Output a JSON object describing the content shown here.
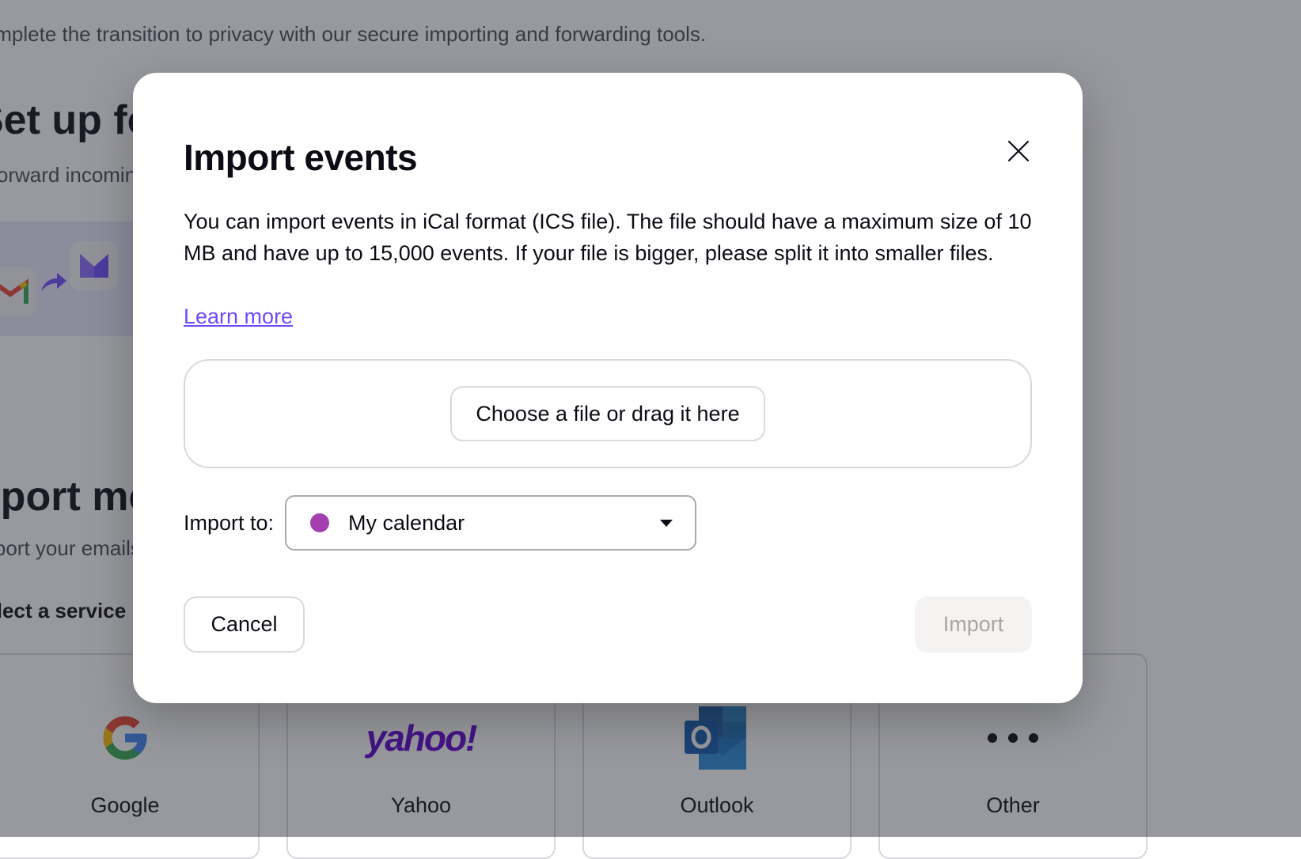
{
  "background": {
    "intro_text": "Complete the transition to privacy with our secure importing and forwarding tools.",
    "forward_section": {
      "title": "Set up forwarding",
      "subtitle": "Forward incoming mail"
    },
    "import_section": {
      "title": "Import messages",
      "subtitle": "Import your emails",
      "select_service_label": "Select a service"
    },
    "services": [
      {
        "name": "Google",
        "icon": "google-logo"
      },
      {
        "name": "Yahoo",
        "icon": "yahoo-logo"
      },
      {
        "name": "Outlook",
        "icon": "outlook-logo"
      },
      {
        "name": "Other",
        "icon": "more-dots-icon"
      }
    ]
  },
  "modal": {
    "title": "Import events",
    "description": "You can import events in iCal format (ICS file). The file should have a maximum size of 10 MB and have up to 15,000 events. If your file is bigger, please split it into smaller files.",
    "learn_more": "Learn more",
    "dropzone_button": "Choose a file or drag it here",
    "import_to_label": "Import to:",
    "calendar": {
      "name": "My calendar",
      "color": "#a43fb0"
    },
    "cancel_label": "Cancel",
    "import_label": "Import",
    "import_disabled": true
  },
  "colors": {
    "accent": "#6d4aff",
    "yahoo": "#5f01d1",
    "outlook": "#0f6cbd"
  }
}
